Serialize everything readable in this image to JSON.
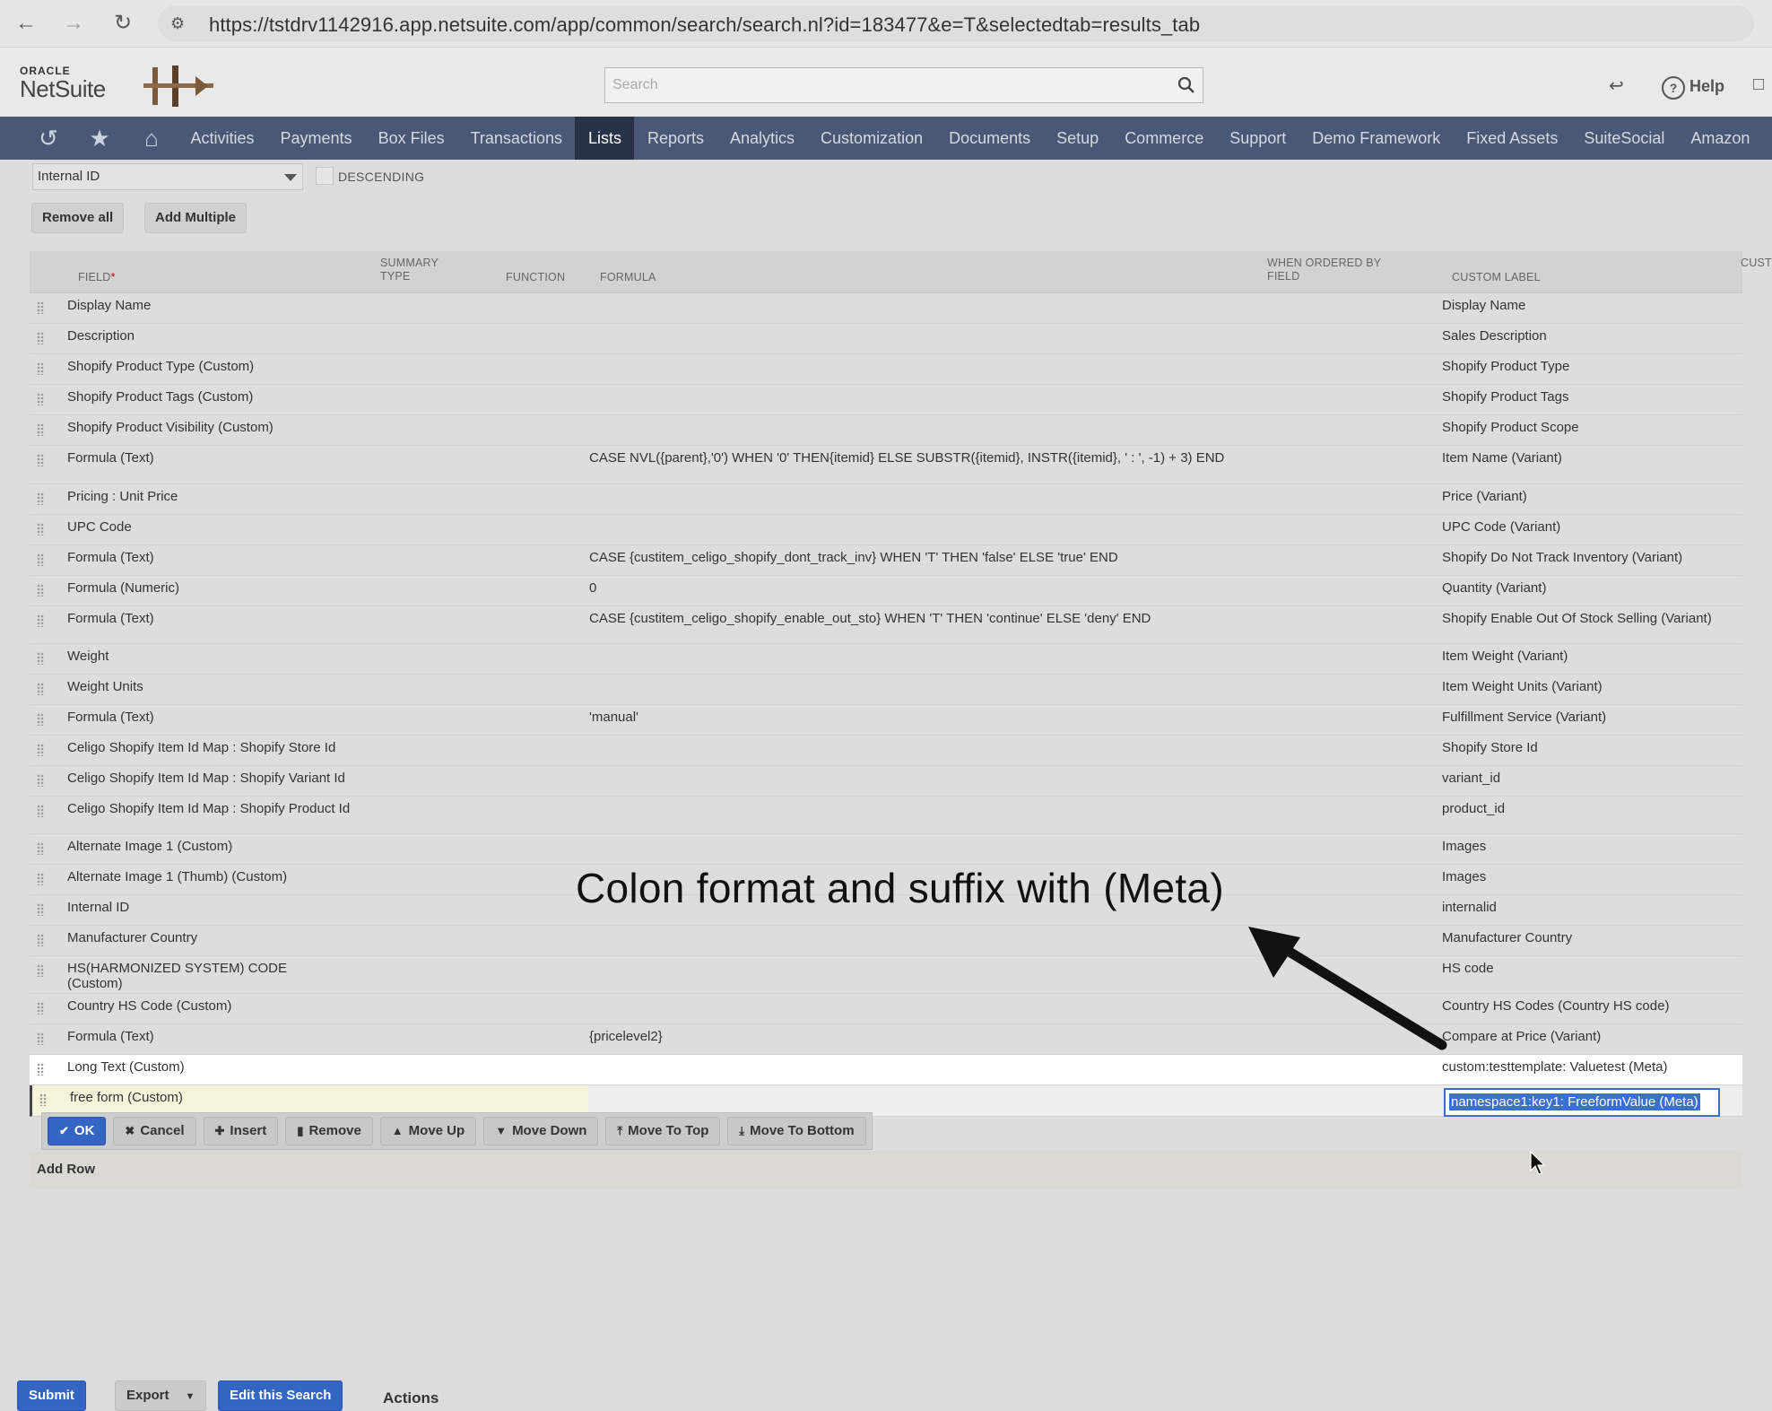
{
  "browser": {
    "url": "https://tstdrv1142916.app.netsuite.com/app/common/search/search.nl?id=183477&e=T&selectedtab=results_tab"
  },
  "header": {
    "logo_oracle": "ORACLE",
    "logo_netsuite": "NetSuite",
    "search_placeholder": "Search",
    "help_label": "Help"
  },
  "nav": {
    "items": [
      {
        "label": "Activities"
      },
      {
        "label": "Payments"
      },
      {
        "label": "Box Files"
      },
      {
        "label": "Transactions"
      },
      {
        "label": "Lists",
        "active": true
      },
      {
        "label": "Reports"
      },
      {
        "label": "Analytics"
      },
      {
        "label": "Customization"
      },
      {
        "label": "Documents"
      },
      {
        "label": "Setup"
      },
      {
        "label": "Commerce"
      },
      {
        "label": "Support"
      },
      {
        "label": "Demo Framework"
      },
      {
        "label": "Fixed Assets"
      },
      {
        "label": "SuiteSocial"
      },
      {
        "label": "Amazon"
      }
    ]
  },
  "sort": {
    "selected": "Internal ID",
    "descending_label": "DESCENDING"
  },
  "buttons": {
    "remove_all": "Remove all",
    "add_multiple": "Add Multiple"
  },
  "table": {
    "headers": {
      "field": "FIELD",
      "summary_type": "SUMMARY TYPE",
      "function": "FUNCTION",
      "formula": "FORMULA",
      "when_ordered_by_field": "WHEN ORDERED BY FIELD",
      "custom_label": "CUSTOM LABEL",
      "cust_trans": "CUST TRAN"
    },
    "rows": [
      {
        "field": "Display Name",
        "formula": "",
        "label": "Display Name"
      },
      {
        "field": "Description",
        "formula": "",
        "label": "Sales Description"
      },
      {
        "field": "Shopify Product Type (Custom)",
        "formula": "",
        "label": "Shopify Product Type"
      },
      {
        "field": "Shopify Product Tags (Custom)",
        "formula": "",
        "label": "Shopify Product Tags"
      },
      {
        "field": "Shopify Product Visibility (Custom)",
        "formula": "",
        "label": "Shopify Product Scope"
      },
      {
        "field": "Formula (Text)",
        "formula": "CASE NVL({parent},'0') WHEN '0' THEN{itemid} ELSE SUBSTR({itemid}, INSTR({itemid}, ' : ', -1) + 3) END",
        "label": "Item Name (Variant)"
      },
      {
        "field": "Pricing : Unit Price",
        "formula": "",
        "label": "Price (Variant)"
      },
      {
        "field": "UPC Code",
        "formula": "",
        "label": "UPC Code (Variant)"
      },
      {
        "field": "Formula (Text)",
        "formula": "CASE {custitem_celigo_shopify_dont_track_inv} WHEN 'T' THEN 'false' ELSE 'true' END",
        "label": "Shopify Do Not Track Inventory (Variant)"
      },
      {
        "field": "Formula (Numeric)",
        "formula": "0",
        "label": "Quantity (Variant)"
      },
      {
        "field": "Formula (Text)",
        "formula": "CASE {custitem_celigo_shopify_enable_out_sto} WHEN 'T' THEN 'continue' ELSE 'deny' END",
        "label": "Shopify Enable Out Of Stock Selling (Variant)"
      },
      {
        "field": "Weight",
        "formula": "",
        "label": "Item Weight (Variant)"
      },
      {
        "field": "Weight Units",
        "formula": "",
        "label": "Item Weight Units (Variant)"
      },
      {
        "field": "Formula (Text)",
        "formula": "'manual'",
        "label": "Fulfillment Service (Variant)"
      },
      {
        "field": "Celigo Shopify Item Id Map : Shopify Store Id",
        "formula": "",
        "label": "Shopify Store Id"
      },
      {
        "field": "Celigo Shopify Item Id Map : Shopify Variant Id",
        "formula": "",
        "label": "variant_id"
      },
      {
        "field": "Celigo Shopify Item Id Map : Shopify Product Id",
        "formula": "",
        "label": "product_id"
      },
      {
        "field": "Alternate Image 1 (Custom)",
        "formula": "",
        "label": "Images"
      },
      {
        "field": "Alternate Image 1 (Thumb) (Custom)",
        "formula": "",
        "label": "Images"
      },
      {
        "field": "Internal ID",
        "formula": "",
        "label": "internalid"
      },
      {
        "field": "Manufacturer Country",
        "formula": "",
        "label": "Manufacturer Country"
      },
      {
        "field": "HS(HARMONIZED SYSTEM) CODE (Custom)",
        "formula": "",
        "label": "HS code"
      },
      {
        "field": "Country HS Code (Custom)",
        "formula": "",
        "label": "Country HS Codes (Country HS code)"
      },
      {
        "field": "Formula (Text)",
        "formula": "{pricelevel2}",
        "label": "Compare at Price (Variant)"
      },
      {
        "field": "Long Text (Custom)",
        "formula": "",
        "label": "custom:testtemplate: Valuetest (Meta)"
      }
    ],
    "editing_row": {
      "field": "free form (Custom)",
      "label_value": "namespace1:key1: FreeformValue (Meta)"
    }
  },
  "row_actions": {
    "ok": "OK",
    "cancel": "Cancel",
    "insert": "Insert",
    "remove": "Remove",
    "move_up": "Move Up",
    "move_down": "Move Down",
    "move_to_top": "Move To Top",
    "move_to_bottom": "Move To Bottom"
  },
  "add_row": "Add Row",
  "annotation": "Colon format and suffix with (Meta)",
  "footer": {
    "submit": "Submit",
    "export": "Export",
    "edit_search": "Edit this Search",
    "actions": "Actions"
  },
  "colors": {
    "nav_bg": "#495875",
    "nav_active": "#28334a",
    "primary_button": "#3464c4"
  }
}
